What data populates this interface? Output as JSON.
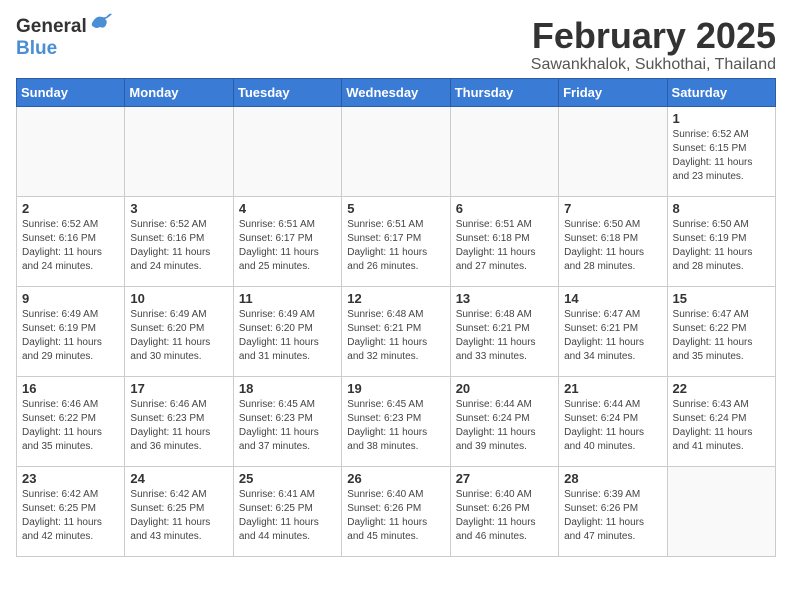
{
  "header": {
    "logo_general": "General",
    "logo_blue": "Blue",
    "title": "February 2025",
    "subtitle": "Sawankhalok, Sukhothai, Thailand"
  },
  "weekdays": [
    "Sunday",
    "Monday",
    "Tuesday",
    "Wednesday",
    "Thursday",
    "Friday",
    "Saturday"
  ],
  "weeks": [
    [
      {
        "day": "",
        "info": ""
      },
      {
        "day": "",
        "info": ""
      },
      {
        "day": "",
        "info": ""
      },
      {
        "day": "",
        "info": ""
      },
      {
        "day": "",
        "info": ""
      },
      {
        "day": "",
        "info": ""
      },
      {
        "day": "1",
        "info": "Sunrise: 6:52 AM\nSunset: 6:15 PM\nDaylight: 11 hours\nand 23 minutes."
      }
    ],
    [
      {
        "day": "2",
        "info": "Sunrise: 6:52 AM\nSunset: 6:16 PM\nDaylight: 11 hours\nand 24 minutes."
      },
      {
        "day": "3",
        "info": "Sunrise: 6:52 AM\nSunset: 6:16 PM\nDaylight: 11 hours\nand 24 minutes."
      },
      {
        "day": "4",
        "info": "Sunrise: 6:51 AM\nSunset: 6:17 PM\nDaylight: 11 hours\nand 25 minutes."
      },
      {
        "day": "5",
        "info": "Sunrise: 6:51 AM\nSunset: 6:17 PM\nDaylight: 11 hours\nand 26 minutes."
      },
      {
        "day": "6",
        "info": "Sunrise: 6:51 AM\nSunset: 6:18 PM\nDaylight: 11 hours\nand 27 minutes."
      },
      {
        "day": "7",
        "info": "Sunrise: 6:50 AM\nSunset: 6:18 PM\nDaylight: 11 hours\nand 28 minutes."
      },
      {
        "day": "8",
        "info": "Sunrise: 6:50 AM\nSunset: 6:19 PM\nDaylight: 11 hours\nand 28 minutes."
      }
    ],
    [
      {
        "day": "9",
        "info": "Sunrise: 6:49 AM\nSunset: 6:19 PM\nDaylight: 11 hours\nand 29 minutes."
      },
      {
        "day": "10",
        "info": "Sunrise: 6:49 AM\nSunset: 6:20 PM\nDaylight: 11 hours\nand 30 minutes."
      },
      {
        "day": "11",
        "info": "Sunrise: 6:49 AM\nSunset: 6:20 PM\nDaylight: 11 hours\nand 31 minutes."
      },
      {
        "day": "12",
        "info": "Sunrise: 6:48 AM\nSunset: 6:21 PM\nDaylight: 11 hours\nand 32 minutes."
      },
      {
        "day": "13",
        "info": "Sunrise: 6:48 AM\nSunset: 6:21 PM\nDaylight: 11 hours\nand 33 minutes."
      },
      {
        "day": "14",
        "info": "Sunrise: 6:47 AM\nSunset: 6:21 PM\nDaylight: 11 hours\nand 34 minutes."
      },
      {
        "day": "15",
        "info": "Sunrise: 6:47 AM\nSunset: 6:22 PM\nDaylight: 11 hours\nand 35 minutes."
      }
    ],
    [
      {
        "day": "16",
        "info": "Sunrise: 6:46 AM\nSunset: 6:22 PM\nDaylight: 11 hours\nand 35 minutes."
      },
      {
        "day": "17",
        "info": "Sunrise: 6:46 AM\nSunset: 6:23 PM\nDaylight: 11 hours\nand 36 minutes."
      },
      {
        "day": "18",
        "info": "Sunrise: 6:45 AM\nSunset: 6:23 PM\nDaylight: 11 hours\nand 37 minutes."
      },
      {
        "day": "19",
        "info": "Sunrise: 6:45 AM\nSunset: 6:23 PM\nDaylight: 11 hours\nand 38 minutes."
      },
      {
        "day": "20",
        "info": "Sunrise: 6:44 AM\nSunset: 6:24 PM\nDaylight: 11 hours\nand 39 minutes."
      },
      {
        "day": "21",
        "info": "Sunrise: 6:44 AM\nSunset: 6:24 PM\nDaylight: 11 hours\nand 40 minutes."
      },
      {
        "day": "22",
        "info": "Sunrise: 6:43 AM\nSunset: 6:24 PM\nDaylight: 11 hours\nand 41 minutes."
      }
    ],
    [
      {
        "day": "23",
        "info": "Sunrise: 6:42 AM\nSunset: 6:25 PM\nDaylight: 11 hours\nand 42 minutes."
      },
      {
        "day": "24",
        "info": "Sunrise: 6:42 AM\nSunset: 6:25 PM\nDaylight: 11 hours\nand 43 minutes."
      },
      {
        "day": "25",
        "info": "Sunrise: 6:41 AM\nSunset: 6:25 PM\nDaylight: 11 hours\nand 44 minutes."
      },
      {
        "day": "26",
        "info": "Sunrise: 6:40 AM\nSunset: 6:26 PM\nDaylight: 11 hours\nand 45 minutes."
      },
      {
        "day": "27",
        "info": "Sunrise: 6:40 AM\nSunset: 6:26 PM\nDaylight: 11 hours\nand 46 minutes."
      },
      {
        "day": "28",
        "info": "Sunrise: 6:39 AM\nSunset: 6:26 PM\nDaylight: 11 hours\nand 47 minutes."
      },
      {
        "day": "",
        "info": ""
      }
    ]
  ]
}
